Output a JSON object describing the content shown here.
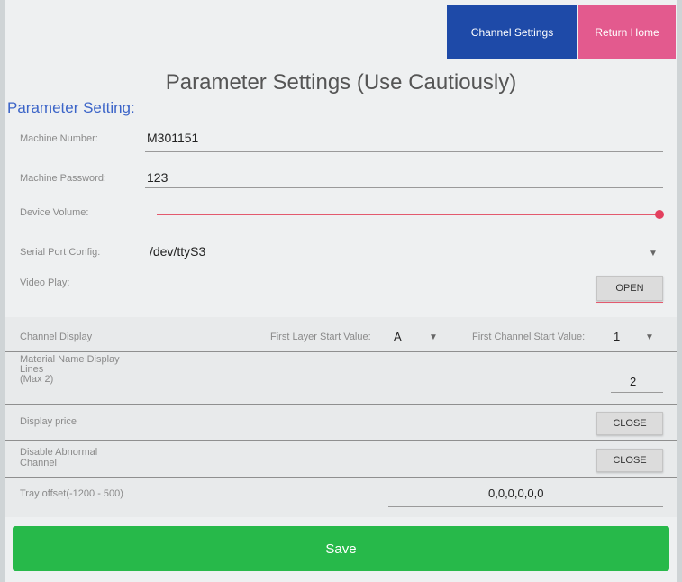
{
  "header": {
    "channel_settings_label": "Channel Settings",
    "return_home_label": "Return Home"
  },
  "page_title": "Parameter Settings (Use Cautiously)",
  "section_title": "Parameter Setting:",
  "fields": {
    "machine_number": {
      "label": "Machine Number:",
      "value": "M301151"
    },
    "machine_password": {
      "label": "Machine Password:",
      "value": "123"
    },
    "device_volume": {
      "label": "Device Volume:",
      "level_fraction": 1.0
    },
    "serial_port": {
      "label": "Serial Port Config:",
      "value": "/dev/ttyS3"
    },
    "video_play": {
      "label": "Video Play:",
      "button": "OPEN"
    }
  },
  "channel_display": {
    "label": "Channel Display",
    "first_layer_label": "First Layer Start Value:",
    "first_layer_value": "A",
    "first_channel_label": "First Channel Start Value:",
    "first_channel_value": "1"
  },
  "material_lines": {
    "label_line1": "Material Name Display",
    "label_line2": "Lines",
    "label_line3": "(Max 2)",
    "value": "2"
  },
  "display_price": {
    "label": "Display price",
    "button": "CLOSE"
  },
  "disable_abnormal": {
    "label_line1": "Disable Abnormal",
    "label_line2": "Channel",
    "button": "CLOSE"
  },
  "tray_offset": {
    "label": "Tray offset(-1200 - 500)",
    "value": "0,0,0,0,0,0"
  },
  "save_label": "Save",
  "colors": {
    "primary_blue": "#1e4aa8",
    "home_pink": "#e35a8e",
    "save_green": "#27b94a",
    "section_blue": "#3b64c8",
    "slider_red": "#e3405e"
  }
}
